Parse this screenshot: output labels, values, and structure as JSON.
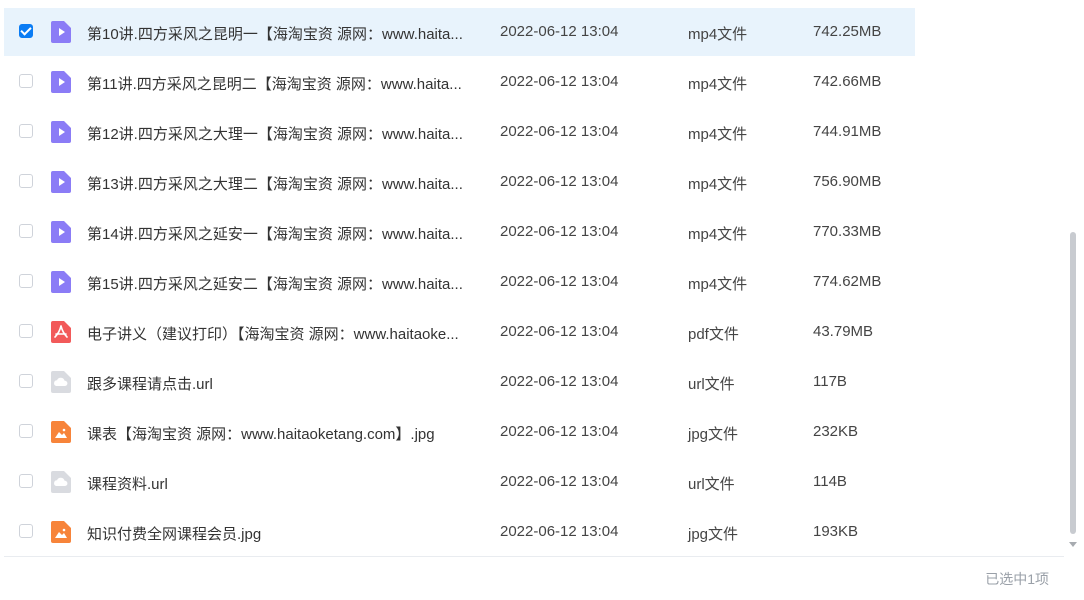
{
  "files": [
    {
      "name": "第10讲.四方采风之昆明一【海淘宝资 源网：www.haita...",
      "date": "2022-06-12 13:04",
      "type": "mp4文件",
      "size": "742.25MB",
      "icon": "video-file-icon",
      "checked": true
    },
    {
      "name": "第11讲.四方采风之昆明二【海淘宝资 源网：www.haita...",
      "date": "2022-06-12 13:04",
      "type": "mp4文件",
      "size": "742.66MB",
      "icon": "video-file-icon",
      "checked": false
    },
    {
      "name": "第12讲.四方采风之大理一【海淘宝资 源网：www.haita...",
      "date": "2022-06-12 13:04",
      "type": "mp4文件",
      "size": "744.91MB",
      "icon": "video-file-icon",
      "checked": false
    },
    {
      "name": "第13讲.四方采风之大理二【海淘宝资 源网：www.haita...",
      "date": "2022-06-12 13:04",
      "type": "mp4文件",
      "size": "756.90MB",
      "icon": "video-file-icon",
      "checked": false
    },
    {
      "name": "第14讲.四方采风之延安一【海淘宝资 源网：www.haita...",
      "date": "2022-06-12 13:04",
      "type": "mp4文件",
      "size": "770.33MB",
      "icon": "video-file-icon",
      "checked": false
    },
    {
      "name": "第15讲.四方采风之延安二【海淘宝资 源网：www.haita...",
      "date": "2022-06-12 13:04",
      "type": "mp4文件",
      "size": "774.62MB",
      "icon": "video-file-icon",
      "checked": false
    },
    {
      "name": "电子讲义（建议打印）【海淘宝资 源网：www.haitaoke...",
      "date": "2022-06-12 13:04",
      "type": "pdf文件",
      "size": "43.79MB",
      "icon": "pdf-file-icon",
      "checked": false
    },
    {
      "name": "跟多课程请点击.url",
      "date": "2022-06-12 13:04",
      "type": "url文件",
      "size": "117B",
      "icon": "url-file-icon",
      "checked": false
    },
    {
      "name": "课表【海淘宝资 源网：www.haitaoketang.com】.jpg",
      "date": "2022-06-12 13:04",
      "type": "jpg文件",
      "size": "232KB",
      "icon": "image-file-icon",
      "checked": false
    },
    {
      "name": "课程资料.url",
      "date": "2022-06-12 13:04",
      "type": "url文件",
      "size": "114B",
      "icon": "url-file-icon",
      "checked": false
    },
    {
      "name": "知识付费全网课程会员.jpg",
      "date": "2022-06-12 13:04",
      "type": "jpg文件",
      "size": "193KB",
      "icon": "image-file-icon",
      "checked": false
    }
  ],
  "colors": {
    "selected_row_bg": "#e8f3fc",
    "checkbox_checked": "#0a7cf4",
    "video_icon": "#8b7cf6",
    "pdf_icon": "#f25a5a",
    "image_icon": "#f7843a",
    "url_icon": "#d9dbe0"
  },
  "status": {
    "selection_text": "已选中1项"
  }
}
